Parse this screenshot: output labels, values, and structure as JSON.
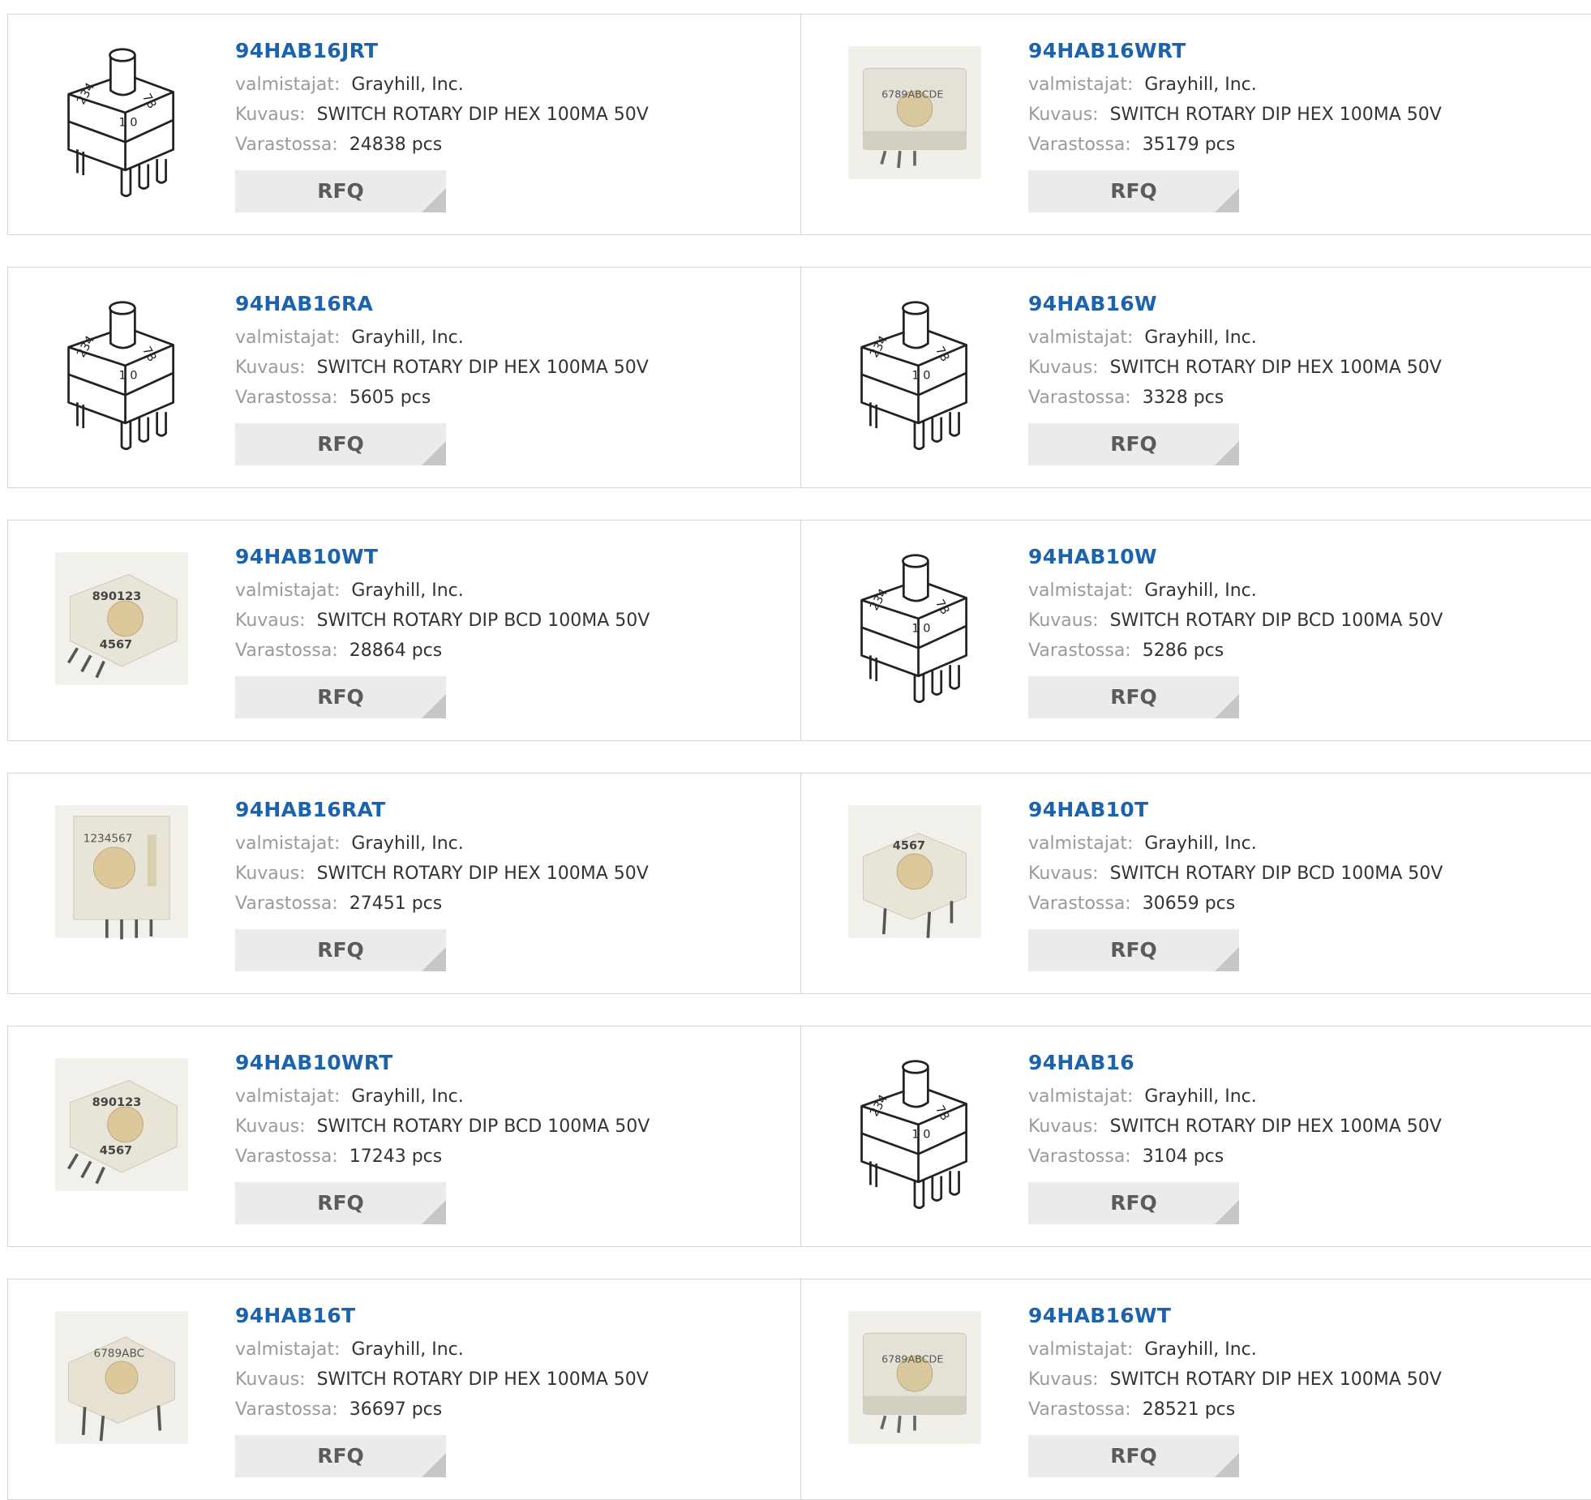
{
  "labels": {
    "manufacturer": "valmistajat:",
    "description": "Kuvaus:",
    "stock": "Varastossa:",
    "rfq": "RFQ"
  },
  "products": [
    {
      "part": "94HAB16JRT",
      "manufacturer": "Grayhill, Inc.",
      "description": "SWITCH ROTARY DIP HEX 100MA 50V",
      "stock": "24838 pcs",
      "image": "rotary-switch-drawing"
    },
    {
      "part": "94HAB16WRT",
      "manufacturer": "Grayhill, Inc.",
      "description": "SWITCH ROTARY DIP HEX 100MA 50V",
      "stock": "35179 pcs",
      "image": "rotary-switch-photo-hex-smd"
    },
    {
      "part": "94HAB16RA",
      "manufacturer": "Grayhill, Inc.",
      "description": "SWITCH ROTARY DIP HEX 100MA 50V",
      "stock": "5605 pcs",
      "image": "rotary-switch-drawing"
    },
    {
      "part": "94HAB16W",
      "manufacturer": "Grayhill, Inc.",
      "description": "SWITCH ROTARY DIP HEX 100MA 50V",
      "stock": "3328 pcs",
      "image": "rotary-switch-drawing"
    },
    {
      "part": "94HAB10WT",
      "manufacturer": "Grayhill, Inc.",
      "description": "SWITCH ROTARY DIP BCD 100MA 50V",
      "stock": "28864 pcs",
      "image": "rotary-switch-photo-bcd-smd"
    },
    {
      "part": "94HAB10W",
      "manufacturer": "Grayhill, Inc.",
      "description": "SWITCH ROTARY DIP BCD 100MA 50V",
      "stock": "5286 pcs",
      "image": "rotary-switch-drawing"
    },
    {
      "part": "94HAB16RAT",
      "manufacturer": "Grayhill, Inc.",
      "description": "SWITCH ROTARY DIP HEX 100MA 50V",
      "stock": "27451 pcs",
      "image": "rotary-switch-photo-right-angle"
    },
    {
      "part": "94HAB10T",
      "manufacturer": "Grayhill, Inc.",
      "description": "SWITCH ROTARY DIP BCD 100MA 50V",
      "stock": "30659 pcs",
      "image": "rotary-switch-photo-bcd-th"
    },
    {
      "part": "94HAB10WRT",
      "manufacturer": "Grayhill, Inc.",
      "description": "SWITCH ROTARY DIP BCD 100MA 50V",
      "stock": "17243 pcs",
      "image": "rotary-switch-photo-bcd-smd"
    },
    {
      "part": "94HAB16",
      "manufacturer": "Grayhill, Inc.",
      "description": "SWITCH ROTARY DIP HEX 100MA 50V",
      "stock": "3104 pcs",
      "image": "rotary-switch-drawing"
    },
    {
      "part": "94HAB16T",
      "manufacturer": "Grayhill, Inc.",
      "description": "SWITCH ROTARY DIP HEX 100MA 50V",
      "stock": "36697 pcs",
      "image": "rotary-switch-photo-hex-th"
    },
    {
      "part": "94HAB16WT",
      "manufacturer": "Grayhill, Inc.",
      "description": "SWITCH ROTARY DIP HEX 100MA 50V",
      "stock": "28521 pcs",
      "image": "rotary-switch-photo-hex-smd"
    }
  ]
}
